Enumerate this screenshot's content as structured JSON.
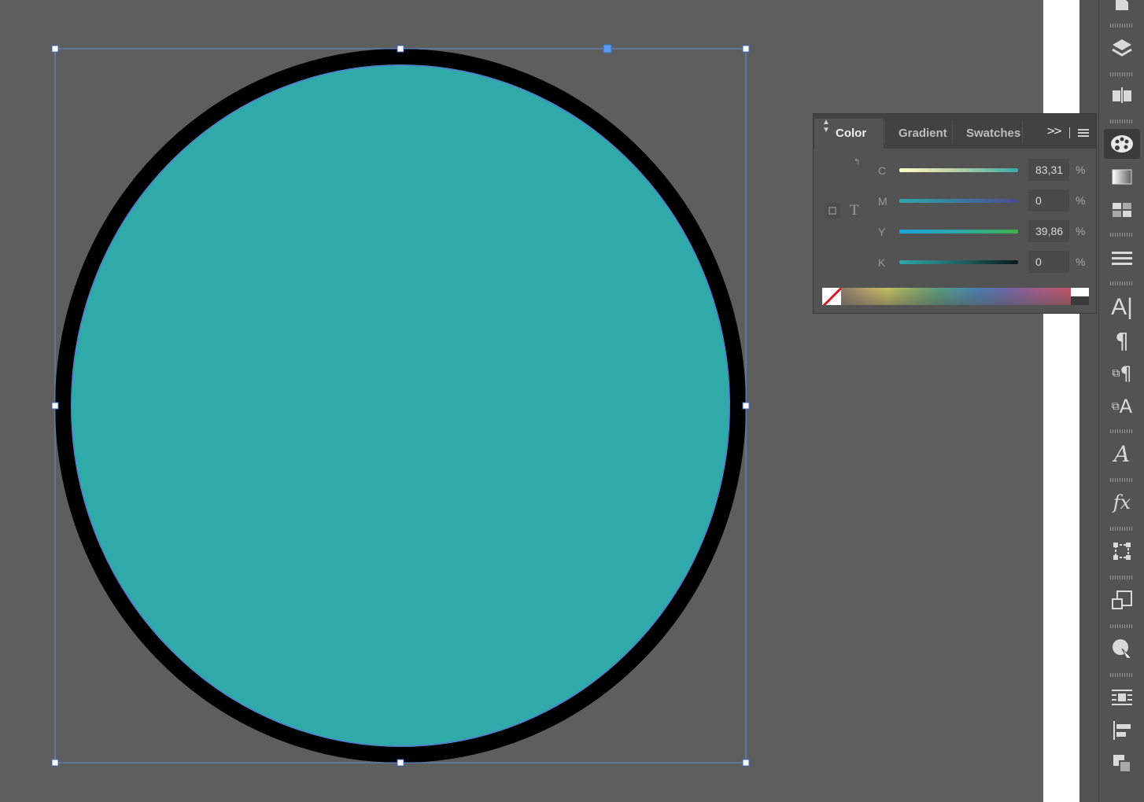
{
  "canvas": {
    "shape_fill": "#2faaa8",
    "shape_stroke": "#000000",
    "frame_color": "#5b8de0",
    "background": "#5e5e5e"
  },
  "color_panel": {
    "tabs": [
      {
        "label": "Color",
        "active": true
      },
      {
        "label": "Gradient",
        "active": false
      },
      {
        "label": "Swatches",
        "active": false
      }
    ],
    "overflow_label": ">>",
    "channels": [
      {
        "letter": "C",
        "value": "83,31",
        "unit": "%"
      },
      {
        "letter": "M",
        "value": "0",
        "unit": "%"
      },
      {
        "letter": "Y",
        "value": "39,86",
        "unit": "%"
      },
      {
        "letter": "K",
        "value": "0",
        "unit": "%"
      }
    ],
    "text_icon": "T"
  },
  "dock": {
    "icons": [
      "pages-icon",
      "layers-icon",
      "links-icon",
      "color-icon",
      "gradient-icon",
      "swatches-icon",
      "stroke-icon",
      "character-icon",
      "paragraph-icon",
      "paragraph-styles-icon",
      "character-styles-icon",
      "glyphs-icon",
      "effects-icon",
      "transform-icon",
      "pathfinder-icon",
      "color-picker-icon",
      "text-wrap-icon",
      "align-icon",
      "object-styles-icon"
    ],
    "active": "color-icon",
    "glyph_text": {
      "effects": "fx",
      "character": "A",
      "glyphs": "𝒜"
    }
  }
}
